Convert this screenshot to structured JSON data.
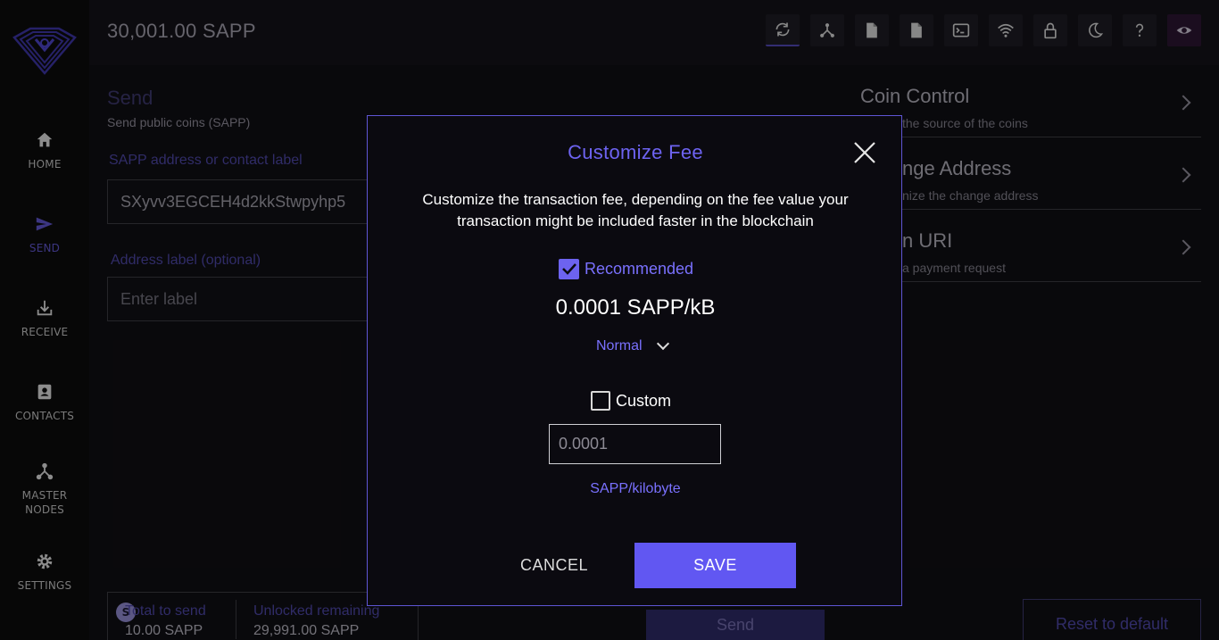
{
  "sidebar": {
    "items": [
      {
        "label": "HOME",
        "icon": "home-icon"
      },
      {
        "label": "SEND",
        "icon": "send-icon",
        "active": true
      },
      {
        "label": "RECEIVE",
        "icon": "receive-icon"
      },
      {
        "label": "CONTACTS",
        "icon": "contacts-icon"
      },
      {
        "label_line1": "MASTER",
        "label_line2": "NODES",
        "icon": "masternodes-icon"
      },
      {
        "label": "SETTINGS",
        "icon": "settings-icon"
      }
    ]
  },
  "topbar": {
    "balance": "30,001.00 SAPP",
    "buttons": [
      "refresh-icon",
      "network-icon",
      "document-icon",
      "document-alt-icon",
      "terminal-icon",
      "wifi-icon",
      "lock-icon",
      "moon-icon",
      "help-icon",
      "eye-icon"
    ]
  },
  "send": {
    "title": "Send",
    "subtitle": "Send public coins (SAPP)",
    "address_label": "SAPP address or contact label",
    "address_value": "SXyvv3EGCEH4d2kkStwpyhp5",
    "addr_label_title": "Address label (optional)",
    "addr_label_placeholder": "Enter label",
    "total_label": "Total to send",
    "total_value": "10.00 SAPP",
    "unlocked_label": "Unlocked remaining",
    "unlocked_value": "29,991.00 SAPP",
    "badge": "S",
    "send_button": "Send",
    "reset_button": "Reset to default"
  },
  "right_panel": {
    "items": [
      {
        "title": "Coin Control",
        "subtitle": "the source of the coins"
      },
      {
        "title": "nge Address",
        "subtitle": "nize the change address"
      },
      {
        "title": "n URI",
        "subtitle": "a payment request"
      }
    ]
  },
  "modal": {
    "title": "Customize Fee",
    "description": "Customize the transaction fee, depending on the fee value your transaction might be included faster in the blockchain",
    "recommended_label": "Recommended",
    "recommended_checked": true,
    "fee_value": "0.0001 SAPP/kB",
    "speed": "Normal",
    "custom_label": "Custom",
    "custom_checked": false,
    "custom_placeholder": "0.0001",
    "unit_label": "SAPP/kilobyte",
    "cancel_button": "CANCEL",
    "save_button": "SAVE"
  },
  "colors": {
    "accent": "#6157f2",
    "accent_text": "#7a71ff",
    "modal_border": "#5e55d4",
    "background": "#0e0d12"
  }
}
